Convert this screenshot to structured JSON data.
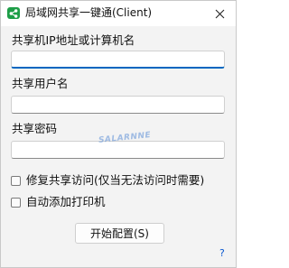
{
  "window": {
    "title": "局域网共享一键通(Client)",
    "app_icon": "share-icon",
    "close_icon": "close-icon"
  },
  "form": {
    "host_label": "共享机IP地址或计算机名",
    "host_value": "",
    "username_label": "共享用户名",
    "username_value": "",
    "password_label": "共享密码",
    "password_value": ""
  },
  "options": {
    "repair_label": "修复共享访问(仅当无法访问时需要)",
    "add_printer_label": "自动添加打印机"
  },
  "actions": {
    "start_label": "开始配置(S)",
    "help_label": "?"
  },
  "watermark": {
    "text": "SALARNNE"
  },
  "colors": {
    "accent": "#0067c0",
    "icon_green": "#1e9e48",
    "link": "#0a58d0"
  }
}
